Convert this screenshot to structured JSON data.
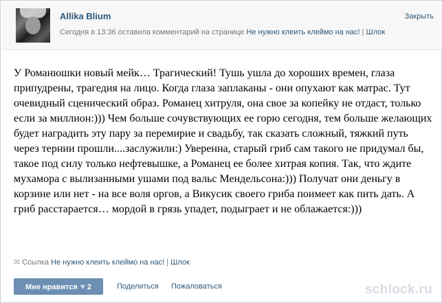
{
  "header": {
    "author": "Allika Blium",
    "meta_prefix": "Сегодня в 13:36 оставила комментарий на странице ",
    "page_link": "Не нужно клеить клеймо на нас!",
    "separator": " | ",
    "source_link": "Шлок",
    "close": "Закрыть"
  },
  "post": {
    "text": "У Романюшки новый мейк… Трагический! Тушь ушла до хороших времен, глаза припудрены, трагедия на лицо. Когда глаза заплаканы - они опухают как матрас. Тут очевидный сценический образ. Романец хитруля, она свое за копейку не отдаст, только если за миллион:))) Чем больше сочувствующих ее горю сегодня, тем больше желающих будет наградить эту пару за перемирие и свадьбу, так сказать сложный, тяжкий путь через тернии прошли....заслужили:) Уверенна, старый гриб сам такого не придумал бы, такое под силу только нефтевышке, а Романец ее более хитрая копия. Так, что ждите мухамора с вылизанными ушами под вальс Мендельсона:))) Получат они деньгу в корзине или нет - на все воля оргов, а Викусик своего гриба поимеет как пить дать. А гриб расстарается… мордой в грязь упадет, подыграет и не облажается:)))"
  },
  "source": {
    "label": "Ссылка ",
    "link": "Не нужно клеить клеймо на нас!",
    "separator": " | ",
    "site": "Шлок"
  },
  "actions": {
    "like_label": "Мне нравится",
    "like_count": "2",
    "share": "Поделиться",
    "report": "Пожаловаться"
  },
  "watermark": "schlock.ru",
  "colors": {
    "link": "#2b587a",
    "button": "#6d8fb3",
    "meta": "#777777"
  }
}
